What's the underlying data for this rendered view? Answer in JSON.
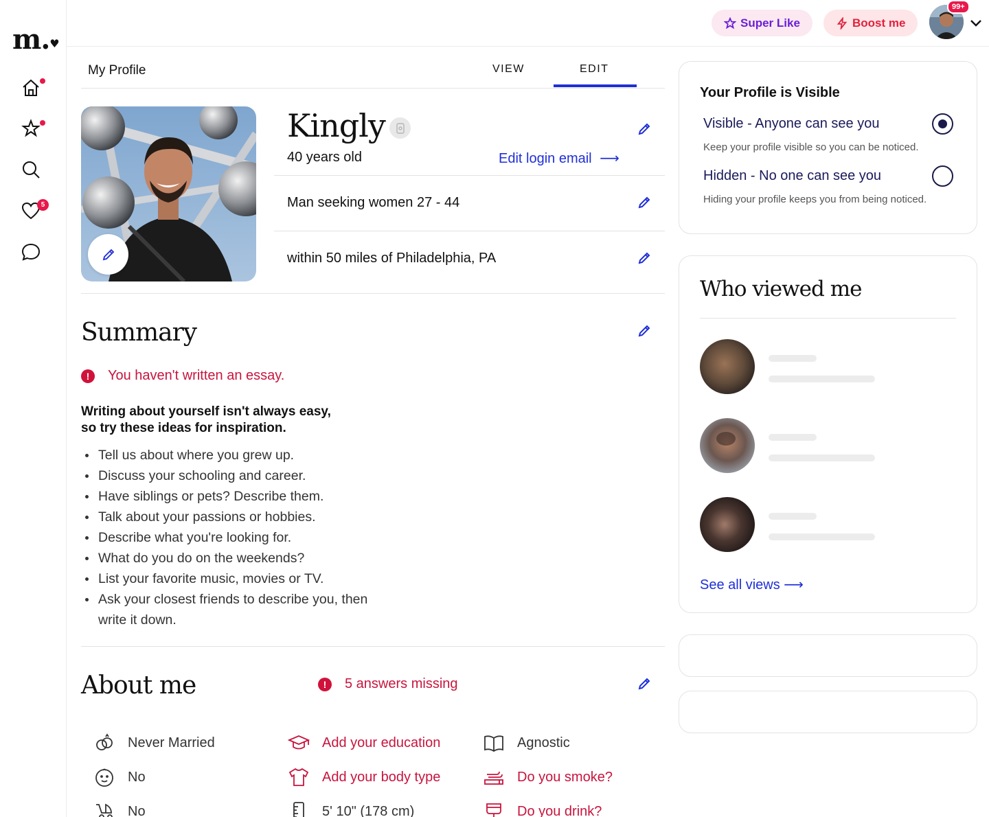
{
  "app": {
    "logo": "m."
  },
  "nav": {
    "likes_badge": "5"
  },
  "topbar": {
    "super_like_label": "Super Like",
    "boost_label": "Boost me",
    "notifications_badge": "99+"
  },
  "profile_tabs": {
    "title": "My Profile",
    "view_label": "VIEW",
    "edit_label": "EDIT",
    "active": "EDIT"
  },
  "profile": {
    "name": "Kingly",
    "age_text": "40 years old",
    "edit_login_label": "Edit login email",
    "seeking": "Man seeking women 27 - 44",
    "location": "within 50 miles of Philadelphia, PA"
  },
  "summary": {
    "heading": "Summary",
    "alert": "You haven't written an essay.",
    "intro_line1": "Writing about yourself isn't always easy,",
    "intro_line2": "so try these ideas for inspiration.",
    "ideas": [
      "Tell us about where you grew up.",
      "Discuss your schooling and career.",
      "Have siblings or pets? Describe them.",
      "Talk about your passions or hobbies.",
      "Describe what you're looking for.",
      "What do you do on the weekends?",
      "List your favorite music, movies or TV.",
      "Ask your closest friends to describe you, then write it down."
    ]
  },
  "about": {
    "heading": "About me",
    "missing_alert": "5 answers missing",
    "items": [
      {
        "icon": "rings-icon",
        "label": "Never Married",
        "missing": false
      },
      {
        "icon": "graduation-cap-icon",
        "label": "Add your education",
        "missing": true
      },
      {
        "icon": "book-icon",
        "label": "Agnostic",
        "missing": false
      },
      {
        "icon": "baby-face-icon",
        "label": "No",
        "missing": false
      },
      {
        "icon": "shirt-icon",
        "label": "Add your body type",
        "missing": true
      },
      {
        "icon": "smoke-icon",
        "label": "Do you smoke?",
        "missing": true
      },
      {
        "icon": "stroller-icon",
        "label": "No",
        "missing": false
      },
      {
        "icon": "ruler-icon",
        "label": "5' 10\" (178 cm)",
        "missing": false
      },
      {
        "icon": "drink-icon",
        "label": "Do you drink?",
        "missing": true
      }
    ]
  },
  "visibility": {
    "title": "Your Profile is Visible",
    "visible_label": "Visible - Anyone can see you",
    "visible_desc": "Keep your profile visible so you can be noticed.",
    "hidden_label": "Hidden - No one can see you",
    "hidden_desc": "Hiding your profile keeps you from being noticed.",
    "selected": "visible"
  },
  "who_viewed": {
    "title": "Who viewed me",
    "see_all_label": "See all views"
  },
  "colors": {
    "accent": "#1f2fd6",
    "alert": "#c8143d",
    "badge": "#e8184b",
    "super_like": "#6a1fd6",
    "boost": "#e0223d"
  }
}
